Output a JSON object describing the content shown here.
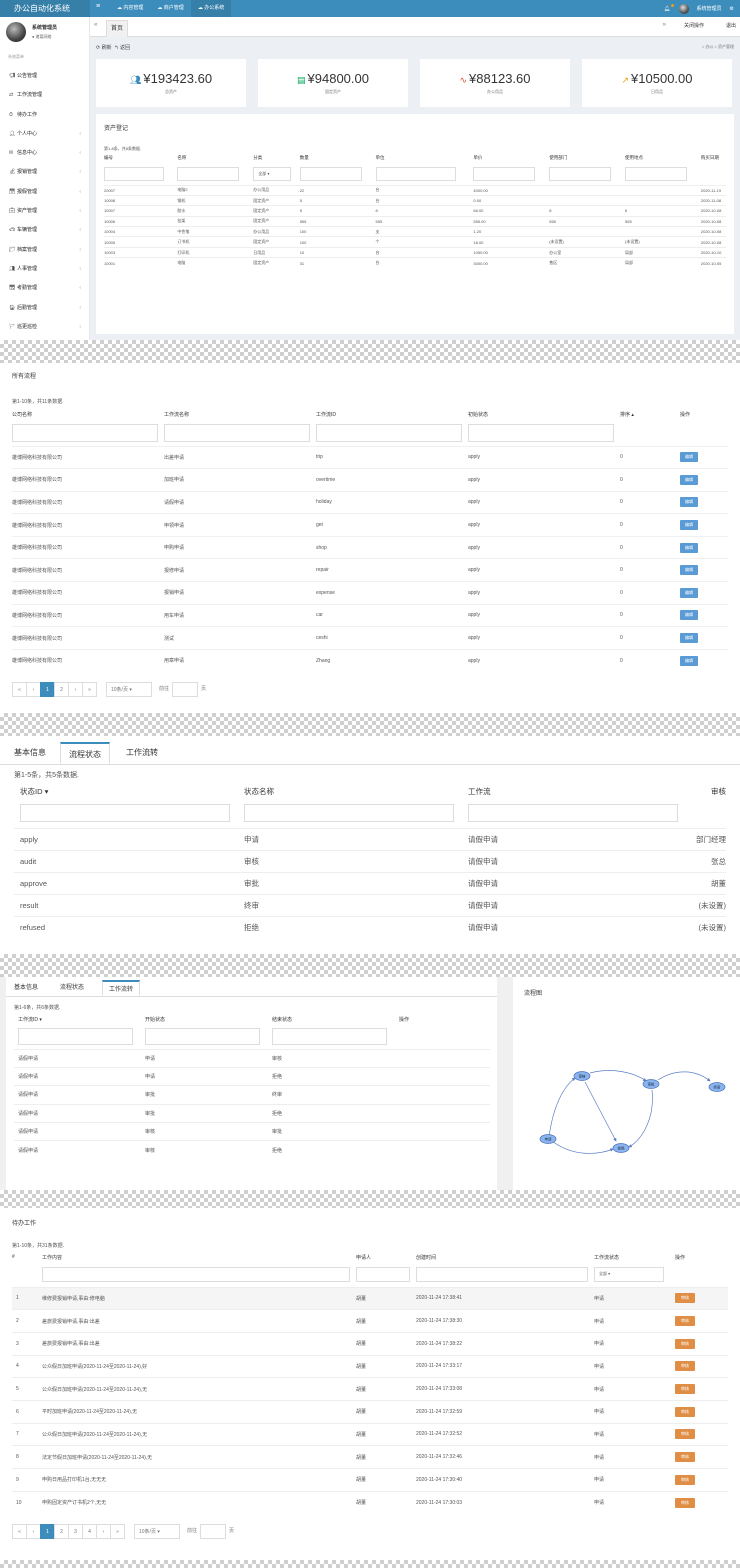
{
  "app": {
    "title": "办公自动化系统",
    "top_nav": [
      "内容管理",
      "商户管理",
      "办公系统"
    ],
    "user_name": "系统管理员"
  },
  "sidebar": {
    "user": "系统管理员",
    "status": "● 诸葛网络",
    "menu_header": "系统菜单",
    "items": [
      "公告管理",
      "工作流管理",
      "待办工作",
      "个人中心",
      "信息中心",
      "报销管理",
      "报假管理",
      "资产管理",
      "车辆管理",
      "档案管理",
      "人事管理",
      "考勤管理",
      "后勤管理",
      "巡更巡检"
    ]
  },
  "tabs": {
    "home": "首页",
    "close_ops": "关闭操作",
    "logout": "退出"
  },
  "toolbar": {
    "refresh": "刷新",
    "back": "返回",
    "breadcrumb": "办公 > 资产管理"
  },
  "stats": [
    {
      "value": "¥193423.60",
      "label": "总资产",
      "color": "#3c8dbc",
      "icon": "users-icon"
    },
    {
      "value": "¥94800.00",
      "label": "固定资产",
      "color": "#00a65a",
      "icon": "card-icon"
    },
    {
      "value": "¥88123.60",
      "label": "办公用品",
      "color": "#dd4b39",
      "icon": "pulse-icon"
    },
    {
      "value": "¥10500.00",
      "label": "日用品",
      "color": "#f39c12",
      "icon": "trend-icon"
    }
  ],
  "asset_box": {
    "title": "资产登记",
    "summary": "第1-8条，共8条数据.",
    "headers": [
      "编号",
      "名称",
      "分类",
      "数量",
      "单位",
      "单价",
      "使用部门",
      "使用地点",
      "购买日期"
    ],
    "filter_select": "全部 ▾",
    "rows": [
      [
        "20007",
        "电脑2",
        "办公用品",
        "22",
        "台",
        "4000.00",
        "",
        "",
        "2020-11-19"
      ],
      [
        "10008",
        "钢机",
        "固定资产",
        "5",
        "台",
        "0.00",
        "",
        "",
        "2020-11-08"
      ],
      [
        "10007",
        "胶水",
        "固定资产",
        "5",
        "8",
        "66.00",
        "8",
        "6",
        "2020-10-08"
      ],
      [
        "10006",
        "挂架",
        "固定资产",
        "555",
        "555",
        "555.00",
        "555",
        "555",
        "2020-10-08"
      ],
      [
        "10004",
        "中性笔",
        "办公用品",
        "100",
        "支",
        "1.20",
        "",
        "",
        "2020-10-08"
      ],
      [
        "10005",
        "订书机",
        "固定资产",
        "100",
        "个",
        "18.00",
        "(未设置)",
        "(未设置)",
        "2020-10-08"
      ],
      [
        "10003",
        "打印机",
        "日用品",
        "10",
        "台",
        "1050.00",
        "办公室",
        "局部",
        "2020-10-10"
      ],
      [
        "10001",
        "电脑",
        "固定资产",
        "31",
        "台",
        "3000.00",
        "售区",
        "局部",
        "2020-10-05"
      ]
    ]
  },
  "workflows": {
    "title": "所有流程",
    "summary": "第1-10条，共11条数据.",
    "headers": [
      "公司名称",
      "工作流名称",
      "工作流ID",
      "初始状态",
      "排序 ▴",
      "操作"
    ],
    "edit_label": "编辑",
    "rows": [
      [
        "雄博网络科技有限公司",
        "出差申请",
        "trip",
        "apply",
        "0"
      ],
      [
        "雄博网络科技有限公司",
        "加班申请",
        "overtime",
        "apply",
        "0"
      ],
      [
        "雄博网络科技有限公司",
        "请假申请",
        "holiday",
        "apply",
        "0"
      ],
      [
        "雄博网络科技有限公司",
        "申领申请",
        "get",
        "apply",
        "0"
      ],
      [
        "雄博网络科技有限公司",
        "申购申请",
        "shop",
        "apply",
        "0"
      ],
      [
        "雄博网络科技有限公司",
        "报修申请",
        "repair",
        "apply",
        "0"
      ],
      [
        "雄博网络科技有限公司",
        "报销申请",
        "expense",
        "apply",
        "0"
      ],
      [
        "雄博网络科技有限公司",
        "用车申请",
        "car",
        "apply",
        "0"
      ],
      [
        "雄博网络科技有限公司",
        "测试",
        "ceshi",
        "apply",
        "0"
      ],
      [
        "雄博网络科技有限公司",
        "用章申请",
        "Zhang",
        "apply",
        "0"
      ]
    ],
    "pager": {
      "pages": [
        "«",
        "‹",
        "1",
        "2",
        "›",
        "»"
      ],
      "active": "1",
      "page_size": "10条/页 ▾",
      "goto": "前往",
      "unit": "页"
    }
  },
  "states": {
    "tabs": [
      "基本信息",
      "流程状态",
      "工作流转"
    ],
    "active_tab": "流程状态",
    "summary": "第1-5条，共5条数据.",
    "headers": [
      "状态ID ▾",
      "状态名称",
      "工作流",
      "审核"
    ],
    "rows": [
      [
        "apply",
        "申请",
        "请假申请",
        "部门经理"
      ],
      [
        "audit",
        "审核",
        "请假申请",
        "张总"
      ],
      [
        "approve",
        "审批",
        "请假申请",
        "胡董"
      ],
      [
        "result",
        "终审",
        "请假申请",
        "(未设置)"
      ],
      [
        "refused",
        "拒绝",
        "请假申请",
        "(未设置)"
      ]
    ]
  },
  "transitions": {
    "tabs": [
      "基本信息",
      "流程状态",
      "工作流转"
    ],
    "active_tab": "工作流转",
    "summary": "第1-6条，共6条数据.",
    "headers": [
      "工作流ID ▾",
      "开始状态",
      "结束状态",
      "操作"
    ],
    "rows": [
      [
        "请假申请",
        "申请",
        "审核"
      ],
      [
        "请假申请",
        "申请",
        "拒绝"
      ],
      [
        "请假申请",
        "审批",
        "终审"
      ],
      [
        "请假申请",
        "审批",
        "拒绝"
      ],
      [
        "请假申请",
        "审核",
        "审批"
      ],
      [
        "请假申请",
        "审核",
        "拒绝"
      ]
    ],
    "diagram_title": "流程图",
    "nodes": [
      "审核",
      "审批",
      "终审",
      "申请",
      "拒绝"
    ]
  },
  "todo": {
    "title": "待办工作",
    "summary": "第1-10条，共31条数据.",
    "headers": [
      "#",
      "工作内容",
      "申请人",
      "创建时间",
      "工作流状态",
      "操作"
    ],
    "filter_select": "全部 ▾",
    "action_label": "审核",
    "rows": [
      [
        "1",
        "维修费报销申请,事由:修电脑",
        "胡董",
        "2020-11-24 17:38:41",
        "申请"
      ],
      [
        "2",
        "差旅费报销申请,事由:出差",
        "胡董",
        "2020-11-24 17:38:30",
        "申请"
      ],
      [
        "3",
        "差旅费报销申请,事由:出差",
        "胡董",
        "2020-11-24 17:38:22",
        "申请"
      ],
      [
        "4",
        "公众假日加班申请(2020-11-24至2020-11-24),好",
        "胡董",
        "2020-11-24 17:33:17",
        "申请"
      ],
      [
        "5",
        "公众假日加班申请(2020-11-24至2020-11-24),无",
        "胡董",
        "2020-11-24 17:33:08",
        "申请"
      ],
      [
        "6",
        "平时加班申请(2020-11-24至2020-11-24),无",
        "胡董",
        "2020-11-24 17:32:59",
        "申请"
      ],
      [
        "7",
        "公众假日加班申请(2020-11-24至2020-11-24),无",
        "胡董",
        "2020-11-24 17:32:52",
        "申请"
      ],
      [
        "8",
        "法定节假日加班申请(2020-11-24至2020-11-24),无",
        "胡董",
        "2020-11-24 17:32:46",
        "申请"
      ],
      [
        "9",
        "申购日用品打印机1台,无无无",
        "胡董",
        "2020-11-24 17:30:40",
        "申请"
      ],
      [
        "10",
        "申购固定资产订书机2个,无无",
        "胡董",
        "2020-11-24 17:30:03",
        "申请"
      ]
    ],
    "pager": {
      "pages": [
        "«",
        "‹",
        "1",
        "2",
        "3",
        "4",
        "›",
        "»"
      ],
      "active": "1",
      "page_size": "10条/页 ▾",
      "goto": "前往",
      "unit": "页"
    }
  }
}
